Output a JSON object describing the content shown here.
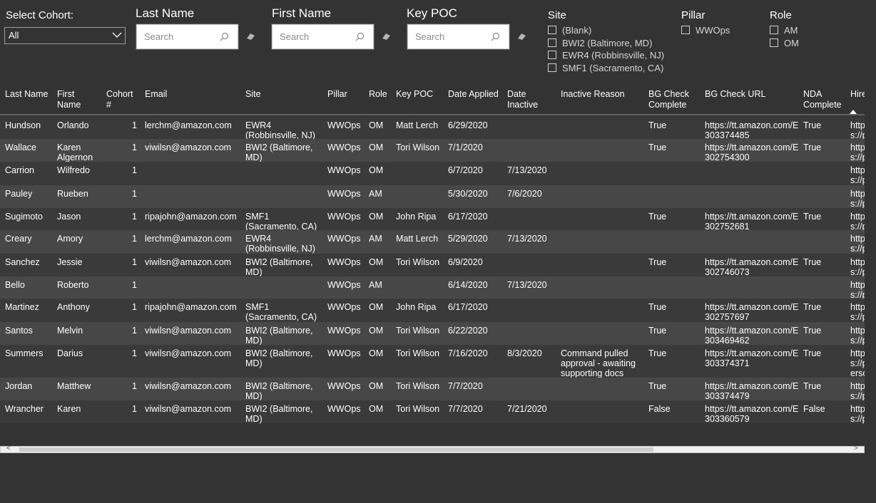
{
  "filters": {
    "cohort": {
      "label": "Select Cohort:",
      "value": "All"
    },
    "last_name": {
      "label": "Last Name",
      "placeholder": "Search"
    },
    "first_name": {
      "label": "First Name",
      "placeholder": "Search"
    },
    "key_poc": {
      "label": "Key POC",
      "placeholder": "Search"
    },
    "site": {
      "label": "Site",
      "options": [
        "(Blank)",
        "BWI2 (Baltimore, MD)",
        "EWR4 (Robbinsville, NJ)",
        "SMF1 (Sacramento, CA)"
      ]
    },
    "pillar": {
      "label": "Pillar",
      "options": [
        "WWOps"
      ]
    },
    "role": {
      "label": "Role",
      "options": [
        "AM",
        "OM"
      ]
    }
  },
  "table": {
    "headers": {
      "last_name": "Last Name",
      "first_name": "First Name",
      "cohort": "Cohort #",
      "email": "Email",
      "site": "Site",
      "pillar": "Pillar",
      "role": "Role",
      "key_poc": "Key POC",
      "date_applied": "Date Applied",
      "date_inactive": "Date Inactive",
      "inactive_reason": "Inactive Reason",
      "bg_complete": "BG Check Complete",
      "bg_url": "BG Check URL",
      "nda": "NDA Complete",
      "hire": "Hire"
    },
    "rows": [
      {
        "last": "Hundson",
        "first": "Orlando",
        "cohort": "1",
        "email": "lerchm@amazon.com",
        "site": "EWR4 (Robbinsville, NJ)",
        "pillar": "WWOps",
        "role": "OM",
        "poc": "Matt Lerch",
        "applied": "6/29/2020",
        "inactive": "",
        "reason": "",
        "bg": "True",
        "url": "https://tt.amazon.com/E303374485",
        "nda": "True",
        "hire": "https://person"
      },
      {
        "last": "Wallace",
        "first": "Karen Algernon",
        "cohort": "1",
        "email": "viwilsn@amazon.com",
        "site": "BWI2 (Baltimore, MD)",
        "pillar": "WWOps",
        "role": "OM",
        "poc": "Tori Wilson",
        "applied": "7/1/2020",
        "inactive": "",
        "reason": "",
        "bg": "True",
        "url": "https://tt.amazon.com/E302754300",
        "nda": "True",
        "hire": "https://person"
      },
      {
        "last": "Carrion",
        "first": "Wilfredo",
        "cohort": "1",
        "email": "",
        "site": "",
        "pillar": "WWOps",
        "role": "OM",
        "poc": "",
        "applied": "6/7/2020",
        "inactive": "7/13/2020",
        "reason": "",
        "bg": "",
        "url": "",
        "nda": "",
        "hire": "https://person"
      },
      {
        "last": "Pauley",
        "first": "Rueben",
        "cohort": "1",
        "email": "",
        "site": "",
        "pillar": "WWOps",
        "role": "AM",
        "poc": "",
        "applied": "5/30/2020",
        "inactive": "7/6/2020",
        "reason": "",
        "bg": "",
        "url": "",
        "nda": "",
        "hire": "https://person"
      },
      {
        "last": "Sugimoto",
        "first": "Jason",
        "cohort": "1",
        "email": "ripajohn@amazon.com",
        "site": "SMF1 (Sacramento, CA)",
        "pillar": "WWOps",
        "role": "OM",
        "poc": "John Ripa",
        "applied": "6/17/2020",
        "inactive": "",
        "reason": "",
        "bg": "True",
        "url": "https://tt.amazon.com/E302752681",
        "nda": "True",
        "hire": "https://person"
      },
      {
        "last": "Creary",
        "first": "Amory",
        "cohort": "1",
        "email": "lerchm@amazon.com",
        "site": "EWR4 (Robbinsville, NJ)",
        "pillar": "WWOps",
        "role": "AM",
        "poc": "Matt Lerch",
        "applied": "5/29/2020",
        "inactive": "7/13/2020",
        "reason": "",
        "bg": "",
        "url": "",
        "nda": "",
        "hire": "https://person"
      },
      {
        "last": "Sanchez",
        "first": "Jessie",
        "cohort": "1",
        "email": "viwilsn@amazon.com",
        "site": "BWI2 (Baltimore, MD)",
        "pillar": "WWOps",
        "role": "OM",
        "poc": "Tori Wilson",
        "applied": "6/9/2020",
        "inactive": "",
        "reason": "",
        "bg": "True",
        "url": "https://tt.amazon.com/E302746073",
        "nda": "True",
        "hire": "https://person"
      },
      {
        "last": "Bello",
        "first": "Roberto",
        "cohort": "1",
        "email": "",
        "site": "",
        "pillar": "WWOps",
        "role": "AM",
        "poc": "",
        "applied": "6/14/2020",
        "inactive": "7/13/2020",
        "reason": "",
        "bg": "",
        "url": "",
        "nda": "",
        "hire": "https://person"
      },
      {
        "last": "Martinez",
        "first": "Anthony",
        "cohort": "1",
        "email": "ripajohn@amazon.com",
        "site": "SMF1 (Sacramento, CA)",
        "pillar": "WWOps",
        "role": "OM",
        "poc": "John Ripa",
        "applied": "6/17/2020",
        "inactive": "",
        "reason": "",
        "bg": "True",
        "url": "https://tt.amazon.com/E302757697",
        "nda": "True",
        "hire": "https://person"
      },
      {
        "last": "Santos",
        "first": "Melvin",
        "cohort": "1",
        "email": "viwilsn@amazon.com",
        "site": "BWI2 (Baltimore, MD)",
        "pillar": "WWOps",
        "role": "OM",
        "poc": "Tori Wilson",
        "applied": "6/22/2020",
        "inactive": "",
        "reason": "",
        "bg": "True",
        "url": "https://tt.amazon.com/E303469462",
        "nda": "True",
        "hire": "https://person"
      },
      {
        "last": "Summers",
        "first": "Darius",
        "cohort": "1",
        "email": "viwilsn@amazon.com",
        "site": "BWI2 (Baltimore, MD)",
        "pillar": "WWOps",
        "role": "OM",
        "poc": "Tori Wilson",
        "applied": "7/16/2020",
        "inactive": "8/3/2020",
        "reason": "Command pulled approval - awaiting supporting docs",
        "bg": "True",
        "url": "https://tt.amazon.com/E303374371",
        "nda": "True",
        "hire": "https://person"
      },
      {
        "last": "Jordan",
        "first": "Matthew",
        "cohort": "1",
        "email": "viwilsn@amazon.com",
        "site": "BWI2 (Baltimore, MD)",
        "pillar": "WWOps",
        "role": "OM",
        "poc": "Tori Wilson",
        "applied": "7/7/2020",
        "inactive": "",
        "reason": "",
        "bg": "True",
        "url": "https://tt.amazon.com/E303374479",
        "nda": "True",
        "hire": "https://person"
      },
      {
        "last": "Wrancher",
        "first": "Karen",
        "cohort": "1",
        "email": "viwilsn@amazon.com",
        "site": "BWI2 (Baltimore, MD)",
        "pillar": "WWOps",
        "role": "OM",
        "poc": "Tori Wilson",
        "applied": "7/7/2020",
        "inactive": "7/21/2020",
        "reason": "",
        "bg": "False",
        "url": "https://tt.amazon.com/E303360579",
        "nda": "False",
        "hire": "https://person"
      }
    ]
  }
}
